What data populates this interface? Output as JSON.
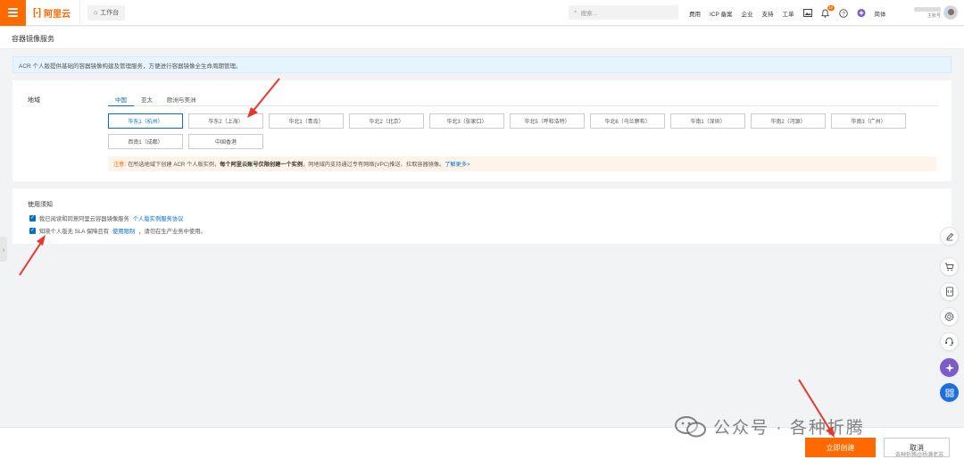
{
  "topnav": {
    "logo_text": "阿里云",
    "workbench_label": "工作台",
    "search_placeholder": "搜索...",
    "links": [
      "费用",
      "ICP 备案",
      "企业",
      "支持",
      "工单"
    ],
    "badge_count": "19",
    "language": "简体",
    "account_role": "主账号"
  },
  "page": {
    "title": "容器镜像服务"
  },
  "info": {
    "text": "ACR 个人版提供基础的容器镜像构建及管理服务，方便进行容器镜像全生命周期管理。"
  },
  "region": {
    "label": "地域",
    "tabs": [
      "中国",
      "亚太",
      "欧洲与美洲"
    ],
    "active_tab": "中国",
    "options": [
      "华东1（杭州）",
      "华东2（上海）",
      "华北1（青岛）",
      "华北2（北京）",
      "华北3（张家口）",
      "华北5（呼和浩特）",
      "华北6（乌兰察布）",
      "华南1（深圳）",
      "华南2（河源）",
      "华南3（广州）",
      "西南1（成都）",
      "中国香港"
    ],
    "selected": "华东1（杭州）",
    "note_prefix": "注意:",
    "note_part1": "在所选地域下创建 ACR 个人版实例，",
    "note_bold": "每个阿里云账号仅限创建一个实例",
    "note_part2": "，同地域内支持通过专有网络(VPC)推送、拉取容器镜像。",
    "note_link": "了解更多>"
  },
  "notice": {
    "title": "使用须知",
    "item1_text": "我已阅读和同意阿里云容器镜像服务",
    "item1_link": "个人版实例服务协议",
    "item2_prefix": "知晓个人版无 SLA 保障且有",
    "item2_link": "使用限制",
    "item2_suffix": "，请勿在生产业务中使用。"
  },
  "footer": {
    "create_label": "立即创建",
    "cancel_label": "取消"
  },
  "watermark": {
    "text": "公众号 · 各种折腾",
    "sub": "各种折腾@杨满老苏"
  },
  "colors": {
    "brand": "#ff6a00",
    "link": "#0070cc",
    "annotation": "#e8362d"
  }
}
